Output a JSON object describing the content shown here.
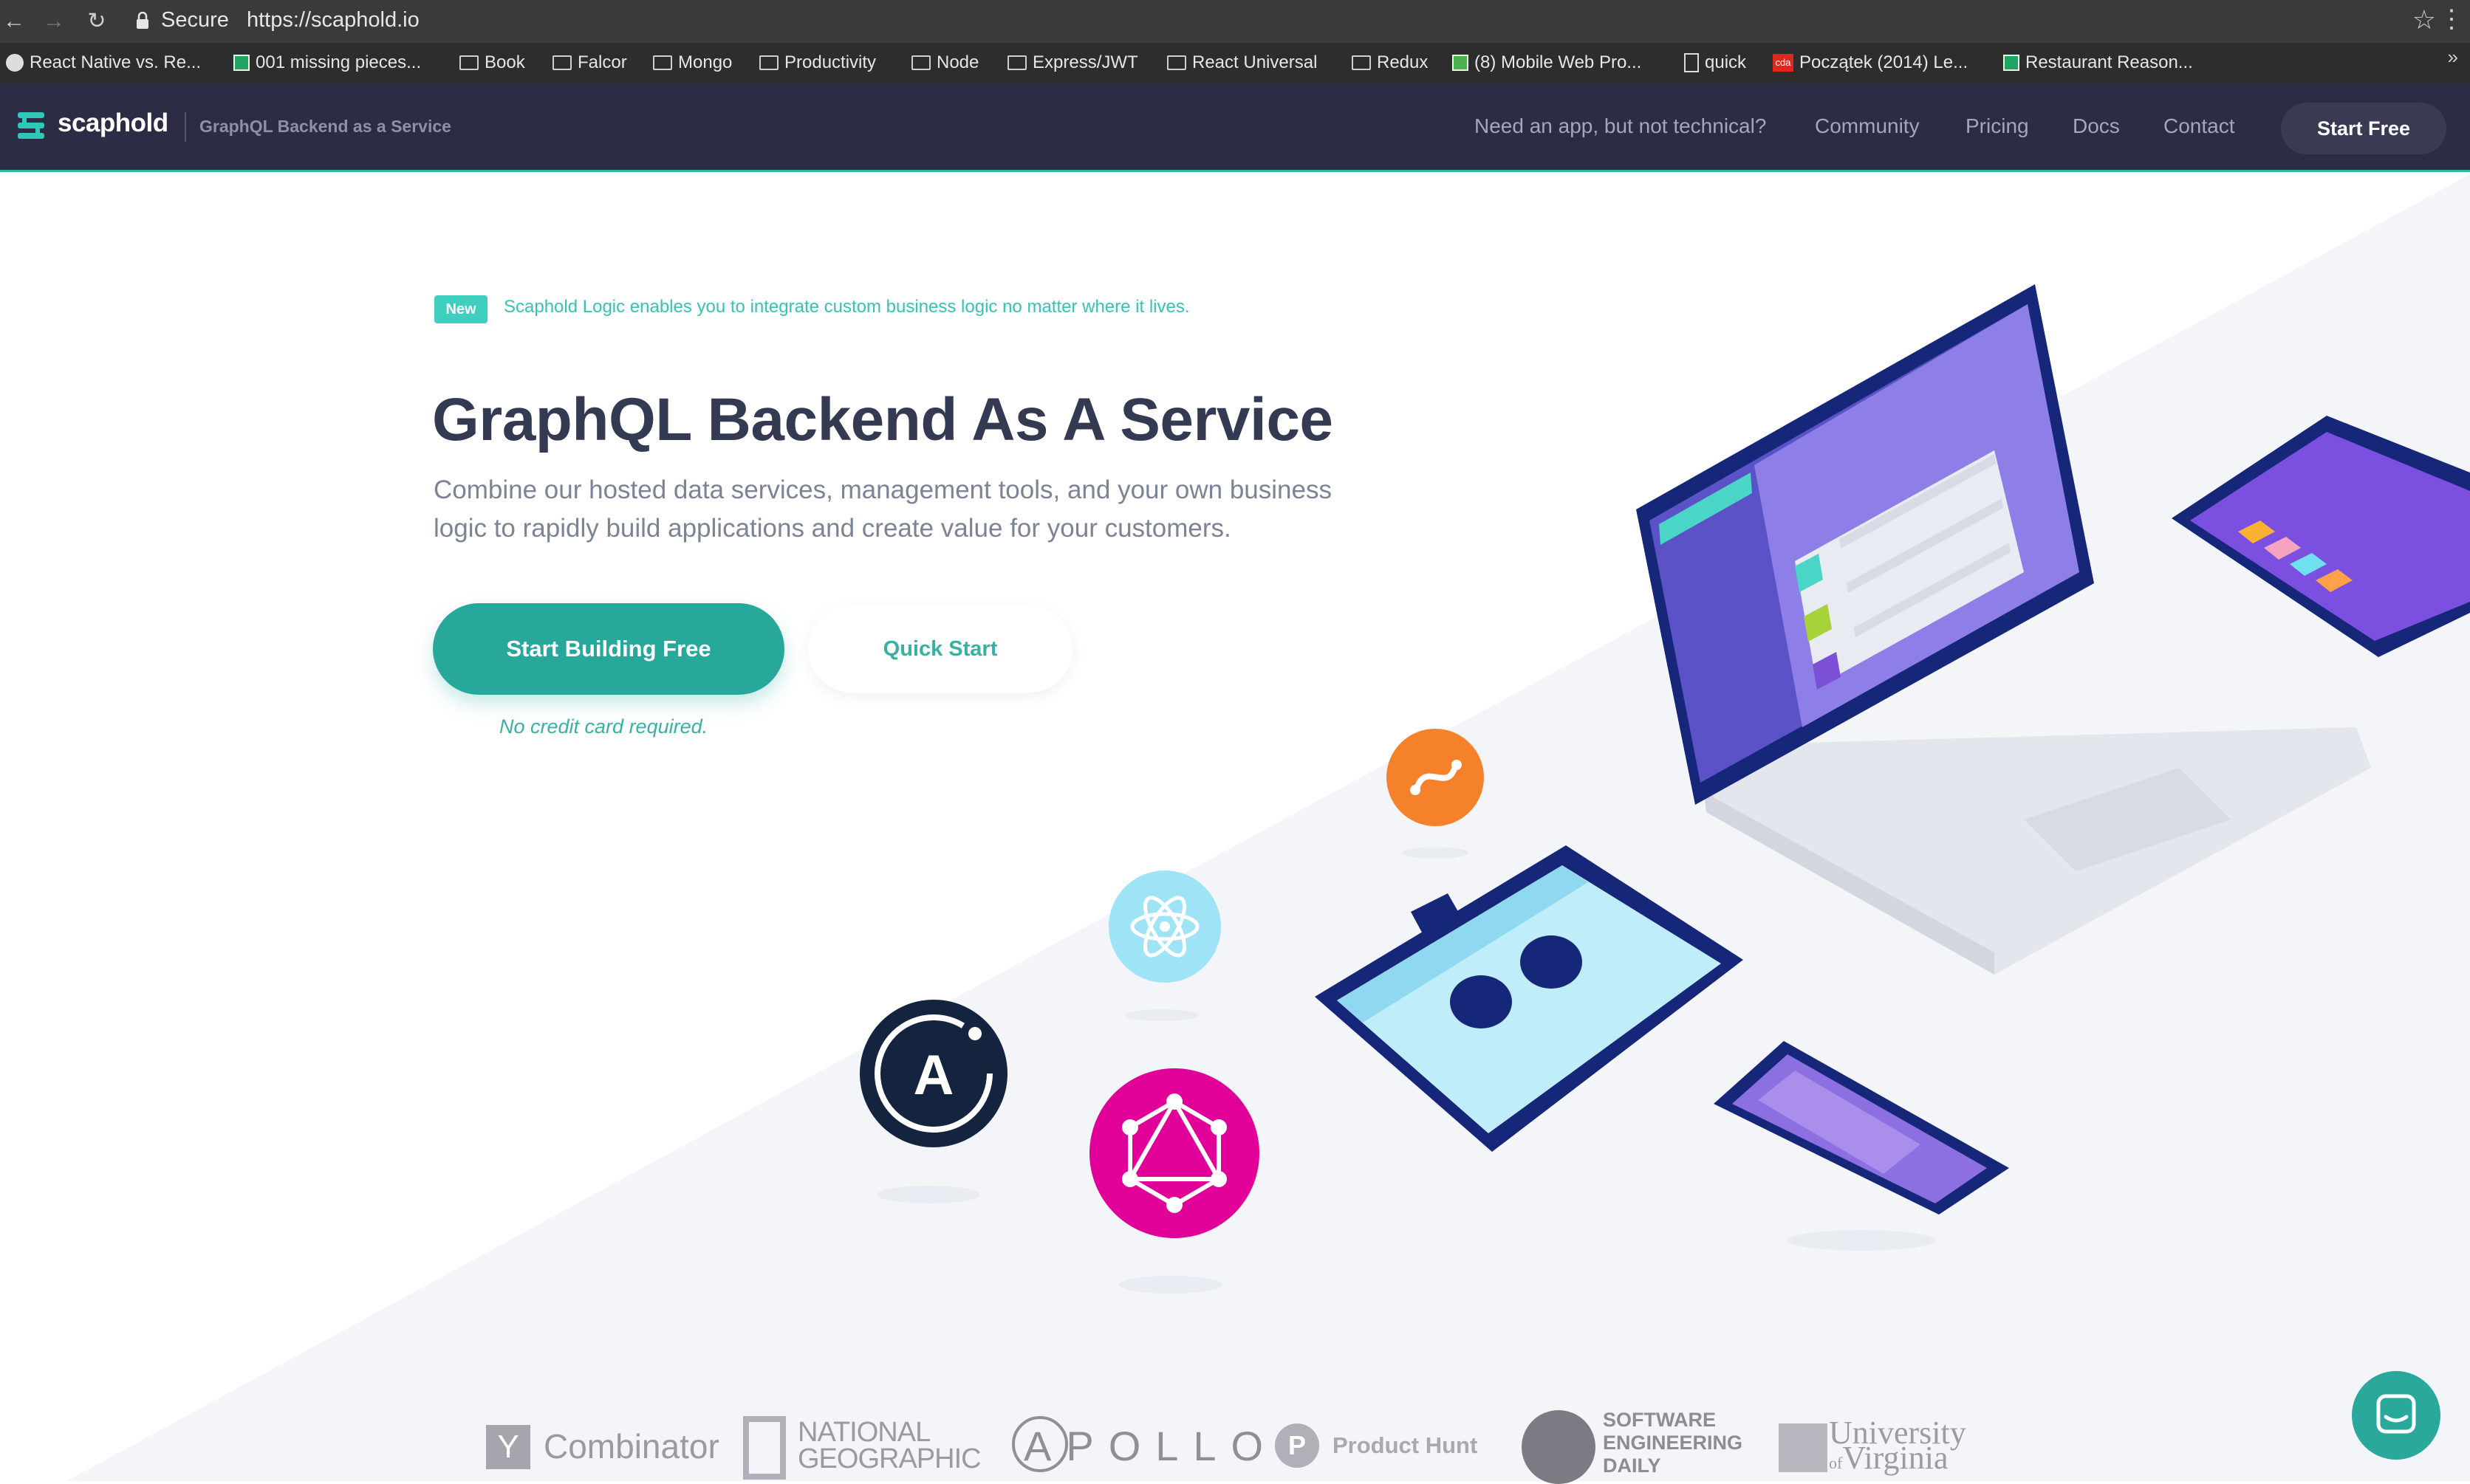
{
  "browser": {
    "security_label": "Secure",
    "url": "https://scaphold.io",
    "bookmarks": [
      {
        "label": "React Native vs. Re...",
        "icon": "github-icon"
      },
      {
        "label": "001 missing pieces...",
        "icon": "sheet-icon"
      },
      {
        "label": "Book",
        "icon": "folder-icon"
      },
      {
        "label": "Falcor",
        "icon": "folder-icon"
      },
      {
        "label": "Mongo",
        "icon": "folder-icon"
      },
      {
        "label": "Productivity",
        "icon": "folder-icon"
      },
      {
        "label": "Node",
        "icon": "folder-icon"
      },
      {
        "label": "Express/JWT",
        "icon": "folder-icon"
      },
      {
        "label": "React Universal",
        "icon": "folder-icon"
      },
      {
        "label": "Redux",
        "icon": "folder-icon"
      },
      {
        "label": "(8) Mobile Web Pro...",
        "icon": "site-icon"
      },
      {
        "label": "quick",
        "icon": "doc-icon"
      },
      {
        "label": "Początek (2014) Le...",
        "icon": "cda-icon"
      },
      {
        "label": "Restaurant Reason...",
        "icon": "sheet-icon"
      }
    ],
    "more_label": "»"
  },
  "header": {
    "logo": "scaphold",
    "tagline": "GraphQL Backend as a Service",
    "nav": [
      "Need an app, but not technical?",
      "Community",
      "Pricing",
      "Docs",
      "Contact"
    ],
    "cta": "Start Free"
  },
  "hero": {
    "badge": "New",
    "announcement": "Scaphold Logic enables you to integrate custom business logic no matter where it lives.",
    "headline": "GraphQL Backend As A Service",
    "subline1": "Combine our hosted data services, management tools, and your own business",
    "subline2": "logic to rapidly build applications and create value for your customers.",
    "primary_cta": "Start Building Free",
    "secondary_cta": "Quick Start",
    "note": "No credit card required."
  },
  "logos": {
    "ycombinator_y": "Y",
    "ycombinator": "Combinator",
    "natgeo_1": "NATIONAL",
    "natgeo_2": "GEOGRAPHIC",
    "apollo": "APOLLO",
    "producthunt_p": "P",
    "producthunt": "Product Hunt",
    "sed_1": "SOFTWARE",
    "sed_2": "ENGINEERING",
    "sed_3": "DAILY",
    "uva_1": "University",
    "uva_2": "Virginia",
    "uva_of": "of"
  },
  "colors": {
    "brand_teal": "#27a89b",
    "header_bg": "#2c2c44",
    "headline": "#333a52",
    "graphql_pink": "#e10098",
    "orange": "#f5822a",
    "navy": "#1e2d7a"
  }
}
